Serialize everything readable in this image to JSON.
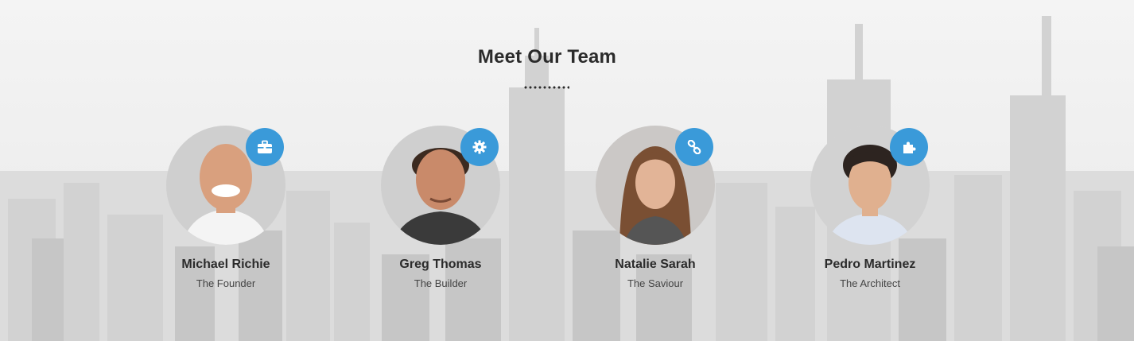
{
  "section": {
    "title": "Meet Our Team"
  },
  "colors": {
    "accent": "#3a9ad9",
    "text": "#2b2b2b"
  },
  "team": [
    {
      "name": "Michael Richie",
      "role": "The Founder",
      "icon": "briefcase-icon"
    },
    {
      "name": "Greg Thomas",
      "role": "The Builder",
      "icon": "gear-icon"
    },
    {
      "name": "Natalie Sarah",
      "role": "The Saviour",
      "icon": "link-icon"
    },
    {
      "name": "Pedro Martinez",
      "role": "The Architect",
      "icon": "puzzle-icon"
    }
  ]
}
